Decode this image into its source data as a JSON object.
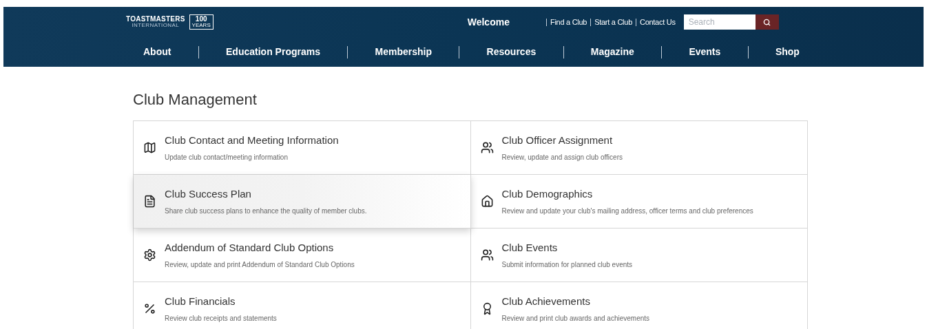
{
  "header": {
    "logo": {
      "name": "TOASTMASTERS",
      "subtitle": "INTERNATIONAL",
      "badge": "100",
      "badge_caption": "YEARS"
    },
    "welcome": "Welcome",
    "links": [
      "Find a Club",
      "Start a Club",
      "Contact Us"
    ],
    "search": {
      "placeholder": "Search"
    }
  },
  "nav": [
    "About",
    "Education Programs",
    "Membership",
    "Resources",
    "Magazine",
    "Events",
    "Shop"
  ],
  "page_title": "Club Management",
  "cards": [
    {
      "kind": "map",
      "title": "Club Contact and Meeting Information",
      "description": "Update club contact/meeting information",
      "highlighted": false
    },
    {
      "kind": "people",
      "title": "Club Officer Assignment",
      "description": "Review, update and assign club officers",
      "highlighted": false
    },
    {
      "kind": "document",
      "title": "Club Success Plan",
      "description": "Share club success plans to enhance the quality of member clubs.",
      "highlighted": true
    },
    {
      "kind": "home",
      "title": "Club Demographics",
      "description": "Review and update your club's mailing address, officer terms and club preferences",
      "highlighted": false
    },
    {
      "kind": "gear",
      "title": "Addendum of Standard Club Options",
      "description": "Review, update and print Addendum of Standard Club Options",
      "highlighted": false
    },
    {
      "kind": "people",
      "title": "Club Events",
      "description": "Submit information for planned club events",
      "highlighted": false
    },
    {
      "kind": "percent",
      "title": "Club Financials",
      "description": "Review club receipts and statements",
      "highlighted": false
    },
    {
      "kind": "award",
      "title": "Club Achievements",
      "description": "Review and print club awards and achievements",
      "highlighted": false
    }
  ]
}
